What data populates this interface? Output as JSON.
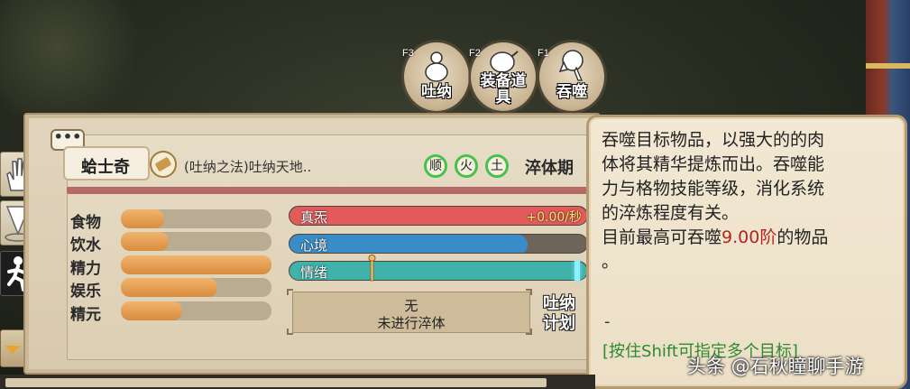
{
  "skills": [
    {
      "hotkey": "F3",
      "label": "吐纳",
      "icon": "gourd-icon"
    },
    {
      "hotkey": "F2",
      "label_line1": "装备道",
      "label_line2": "具",
      "icon": "equipment-item-icon"
    },
    {
      "hotkey": "F1",
      "label": "吞噬",
      "icon": "devour-icon"
    }
  ],
  "panel": {
    "chat_icon": "•••",
    "character_name": "蛤士奇",
    "technique": "(吐纳之法)吐纳天地..",
    "elements": [
      "顺",
      "火",
      "土"
    ],
    "stage": "淬体期"
  },
  "needs": [
    {
      "label": "食物",
      "level": 0.29
    },
    {
      "label": "饮水",
      "level": 0.32
    },
    {
      "label": "精力",
      "level": 1.0
    },
    {
      "label": "娱乐",
      "level": 0.64
    },
    {
      "label": "精元",
      "level": 0.41
    }
  ],
  "stats": {
    "qi_label": "真炁",
    "qi_value": "+0.00/秒",
    "qi_color": "#e35a5a",
    "mood_label": "心境",
    "mood_level": 0.8,
    "mood_color": "#3a8cc8",
    "emotion_label": "情绪",
    "emotion_color": "#3fb3aa"
  },
  "tempering": {
    "line1": "无",
    "line2": "未进行淬体"
  },
  "plan_button": {
    "line1": "吐纳",
    "line2": "计划"
  },
  "tooltip": {
    "lines": [
      "吞噬目标物品，以强大的的肉",
      "体将其精华提炼而出。吞噬能",
      "力与格物技能等级，消化系统",
      "的淬炼程度有关。"
    ],
    "max_prefix": "目前最高可吞噬",
    "max_value": "9.00阶",
    "max_suffix": "的物品",
    "max_tail": "。",
    "dash": "-",
    "hint": "[按住Shift可指定多个目标]",
    "highlight_color": "#b3261e"
  },
  "watermark": "头条 @石秋瞳聊手游"
}
